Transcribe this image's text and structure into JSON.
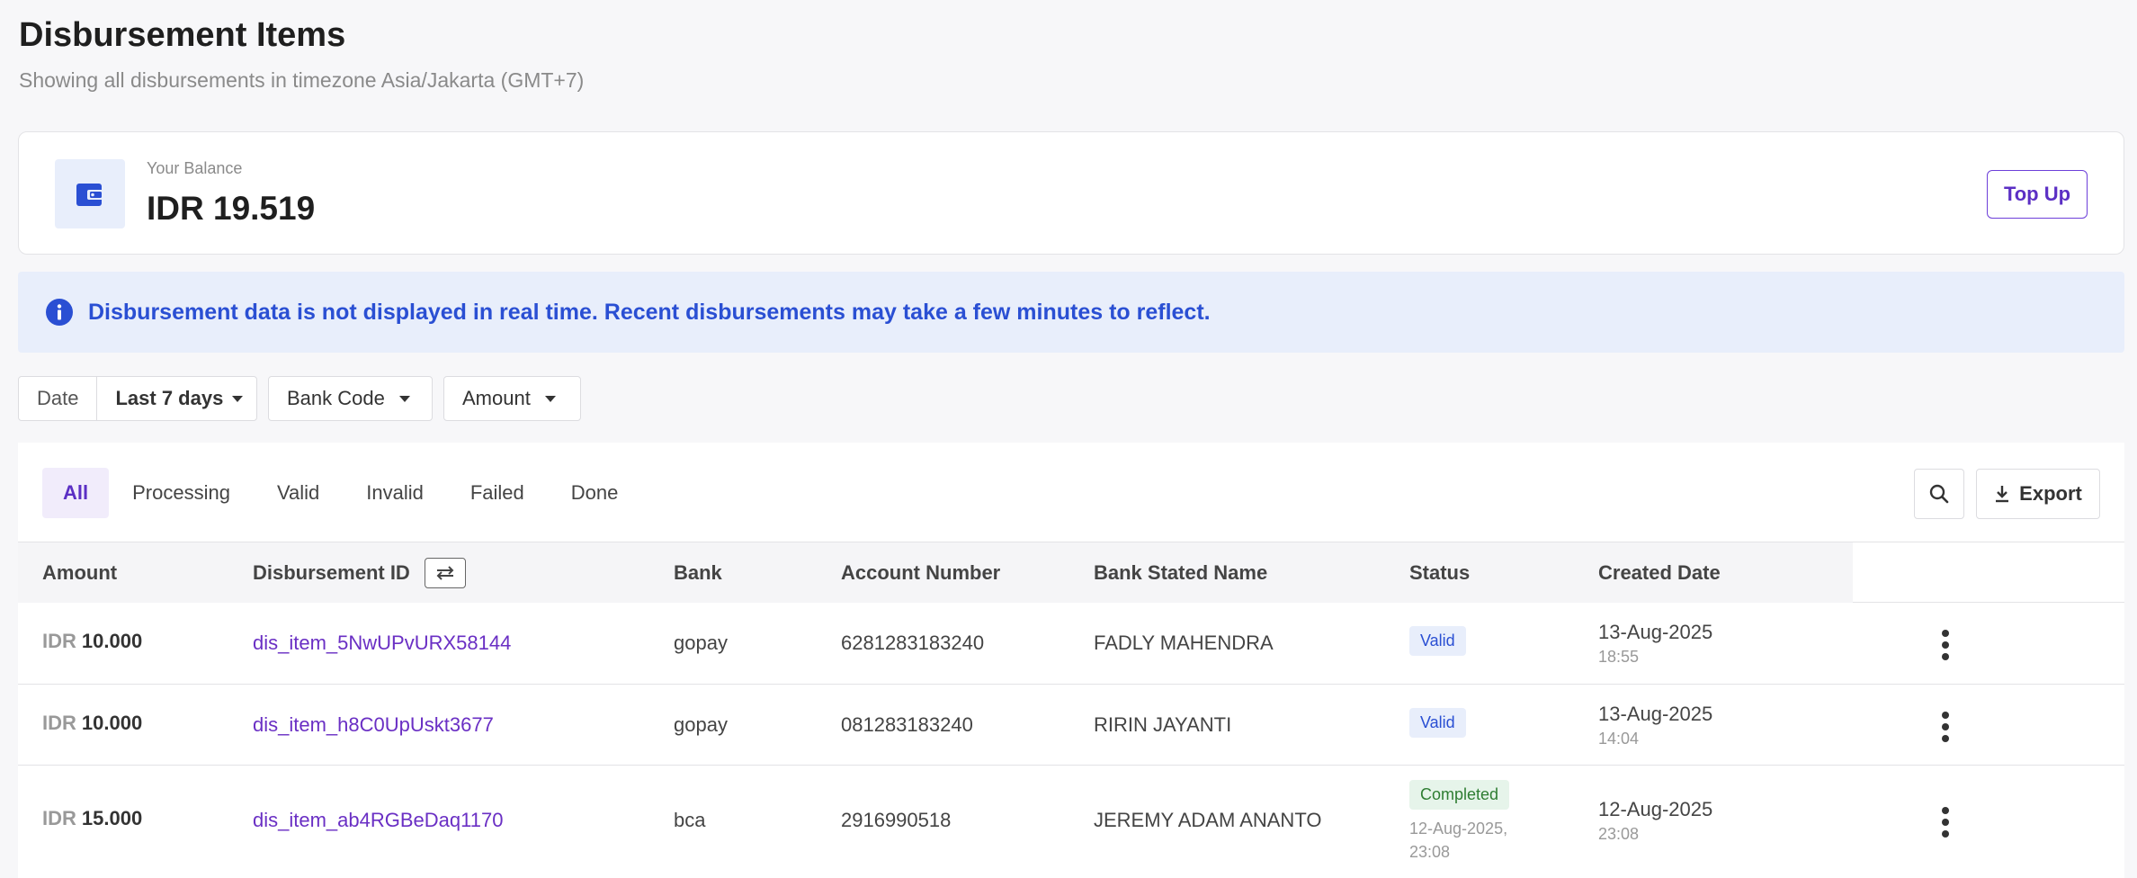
{
  "header": {
    "title": "Disbursement Items",
    "subtitle": "Showing all disbursements in timezone Asia/Jakarta (GMT+7)"
  },
  "balance": {
    "label": "Your Balance",
    "value": "IDR 19.519",
    "topup_label": "Top Up",
    "icon": "wallet-icon"
  },
  "notice": {
    "icon": "info-icon",
    "text": "Disbursement data is not displayed in real time. Recent disbursements may take a few minutes to reflect."
  },
  "filters": {
    "date_label": "Date",
    "date_value": "Last 7 days",
    "bank_code": "Bank Code",
    "amount": "Amount"
  },
  "tabs": [
    "All",
    "Processing",
    "Valid",
    "Invalid",
    "Failed",
    "Done"
  ],
  "actions": {
    "export_label": "Export"
  },
  "columns": {
    "amount": "Amount",
    "disbursement_id": "Disbursement ID",
    "bank": "Bank",
    "account_number": "Account Number",
    "bank_stated_name": "Bank Stated Name",
    "status": "Status",
    "created_date": "Created Date"
  },
  "rows": [
    {
      "currency": "IDR",
      "amount": "10.000",
      "id": "dis_item_5NwUPvURX58144",
      "bank": "gopay",
      "account": "6281283183240",
      "name": "FADLY MAHENDRA",
      "status": "Valid",
      "status_note": "",
      "date": "13-Aug-2025",
      "time": "18:55"
    },
    {
      "currency": "IDR",
      "amount": "10.000",
      "id": "dis_item_h8C0UpUskt3677",
      "bank": "gopay",
      "account": "081283183240",
      "name": "RIRIN JAYANTI",
      "status": "Valid",
      "status_note": "",
      "date": "13-Aug-2025",
      "time": "14:04"
    },
    {
      "currency": "IDR",
      "amount": "15.000",
      "id": "dis_item_ab4RGBeDaq1170",
      "bank": "bca",
      "account": "2916990518",
      "name": "JEREMY ADAM ANANTO",
      "status": "Completed",
      "status_note_1": "12-Aug-2025,",
      "status_note_2": "23:08",
      "date": "12-Aug-2025",
      "time": "23:08"
    }
  ],
  "colors": {
    "accent": "#5b2fc4",
    "info": "#2a4fd3",
    "info_bg": "#e8eefb",
    "success": "#2e7d32"
  }
}
